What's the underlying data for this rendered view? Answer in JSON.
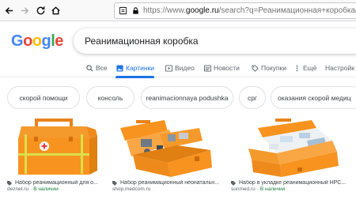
{
  "browser": {
    "url_prefix": "https://www.",
    "url_domain": "google.ru",
    "url_rest": "/search?q=Реанимационная+коробка&newwind"
  },
  "search": {
    "logo": "Google",
    "query": "Реанимационная коробка"
  },
  "tabs": [
    {
      "label": "Все",
      "icon": "search-icon"
    },
    {
      "label": "Картинки",
      "icon": "image-icon",
      "active": true
    },
    {
      "label": "Видео",
      "icon": "play-icon"
    },
    {
      "label": "Новости",
      "icon": "news-icon"
    },
    {
      "label": "Покупки",
      "icon": "tag-icon"
    },
    {
      "label": "Ещё",
      "icon": "more-icon"
    },
    {
      "label": "Настройк",
      "icon": ""
    }
  ],
  "chips": [
    "скорой помощи",
    "консоль",
    "reanimacionnaya podushka",
    "срг",
    "оказания скорой медиц"
  ],
  "results": [
    {
      "title": "Набор реанимационный для о...",
      "source": "deznet.ru",
      "status": "В наличии"
    },
    {
      "title": "Набор реанимационный неонатальн...",
      "source": "shop.medcom.ru",
      "status": ""
    },
    {
      "title": "Набор в укладке реанимационный НРС...",
      "source": "sunmed.ru",
      "status": "В наличии"
    }
  ],
  "colors": {
    "accent": "#1a73e8",
    "box_orange": "#f7931e",
    "available": "#188038"
  }
}
